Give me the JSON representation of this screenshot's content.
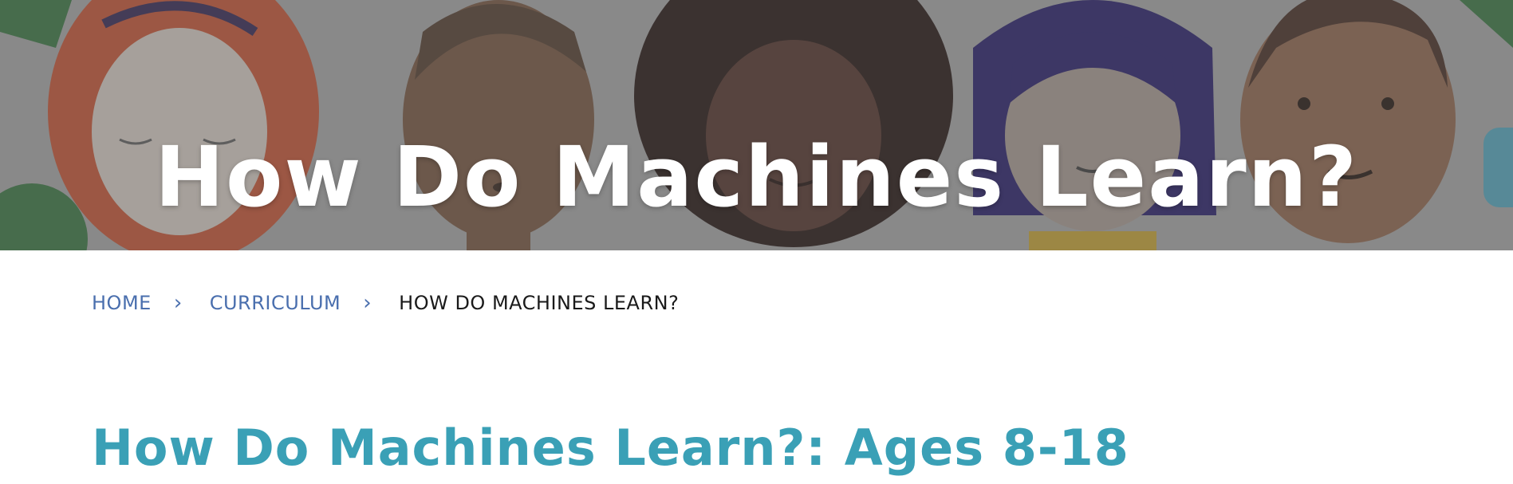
{
  "hero": {
    "title": "How Do Machines Learn?"
  },
  "breadcrumb": {
    "items": [
      {
        "label": "HOME"
      },
      {
        "label": "CURRICULUM"
      }
    ],
    "separator": "›",
    "current": "HOW DO MACHINES LEARN?"
  },
  "main": {
    "title": "How Do Machines Learn?: Ages 8-18"
  },
  "colors": {
    "link": "#4a6fae",
    "heading": "#3aa0b6",
    "hero_text": "#ffffff"
  }
}
